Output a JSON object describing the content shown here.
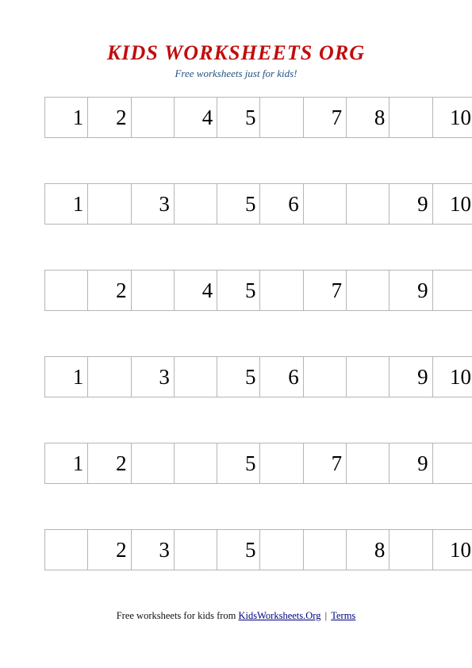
{
  "header": {
    "title": "KIDS WORKSHEETS ORG",
    "subtitle": "Free worksheets just for kids!",
    "title_color": "#c00d0d",
    "subtitle_color": "#21517f"
  },
  "worksheet": {
    "columns": 10,
    "rows": [
      {
        "cells": [
          "1",
          "2",
          "",
          "4",
          "5",
          "",
          "7",
          "8",
          "",
          "10"
        ]
      },
      {
        "cells": [
          "1",
          "",
          "3",
          "",
          "5",
          "6",
          "",
          "",
          "9",
          "10"
        ]
      },
      {
        "cells": [
          "",
          "2",
          "",
          "4",
          "5",
          "",
          "7",
          "",
          "9",
          ""
        ]
      },
      {
        "cells": [
          "1",
          "",
          "3",
          "",
          "5",
          "6",
          "",
          "",
          "9",
          "10"
        ]
      },
      {
        "cells": [
          "1",
          "2",
          "",
          "",
          "5",
          "",
          "7",
          "",
          "9",
          ""
        ]
      },
      {
        "cells": [
          "",
          "2",
          "3",
          "",
          "5",
          "",
          "",
          "8",
          "",
          "10"
        ]
      }
    ],
    "border_color": "#b5b5b5"
  },
  "footer": {
    "text_before": "Free worksheets for kids from ",
    "site_link": "KidsWorksheets.Org",
    "separator": " | ",
    "terms_link": "Terms",
    "link_color": "#000080"
  }
}
